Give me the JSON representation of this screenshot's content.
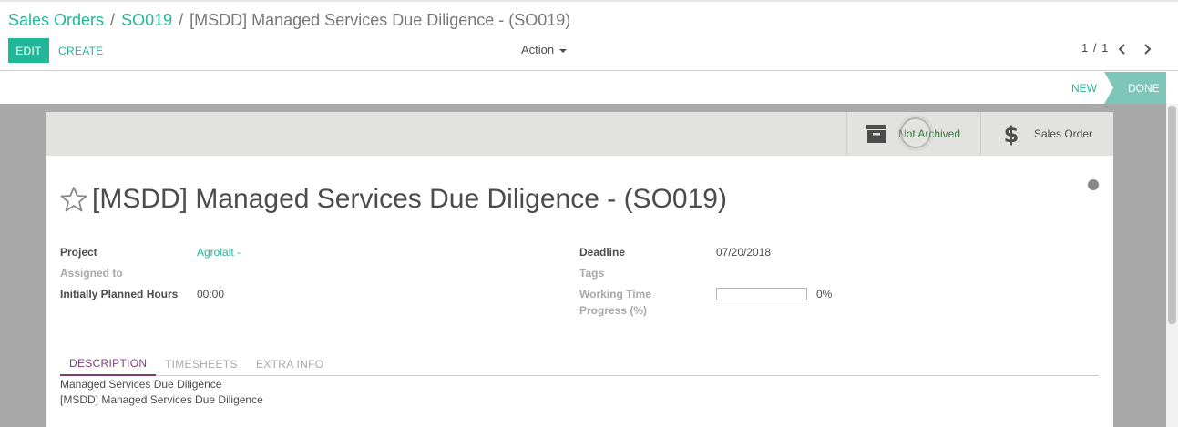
{
  "breadcrumb": {
    "root": "Sales Orders",
    "parent": "SO019",
    "current": "[MSDD] Managed Services Due Diligence - (SO019)",
    "separator": "/"
  },
  "toolbar": {
    "edit_label": "EDIT",
    "create_label": "CREATE",
    "action_label": "Action",
    "pager_text": "1 / 1"
  },
  "statusbar": {
    "stages": [
      "NEW",
      "DONE"
    ],
    "active_stage": "DONE"
  },
  "smart_buttons": {
    "archive_label": "Not Archived",
    "sales_order_label": "Sales Order"
  },
  "record": {
    "title": "[MSDD] Managed Services Due Diligence - (SO019)",
    "fields_left": [
      {
        "label": "Project",
        "value": "Agrolait -"
      },
      {
        "label": "Assigned to",
        "value": ""
      },
      {
        "label": "Initially Planned Hours",
        "value": "00:00"
      }
    ],
    "fields_right": [
      {
        "label": "Deadline",
        "value": "07/20/2018"
      },
      {
        "label": "Tags",
        "value": ""
      },
      {
        "label": "Working Time\nProgress (%)",
        "value": "0%"
      }
    ],
    "progress_fraction": 0
  },
  "notebook": {
    "tabs": [
      "DESCRIPTION",
      "TIMESHEETS",
      "EXTRA INFO"
    ],
    "active_tab": "DESCRIPTION",
    "description_lines": [
      "Managed Services Due Diligence",
      "[MSDD] Managed Services Due Diligence"
    ]
  },
  "colors": {
    "accent": "#21b799",
    "active_tab": "#7c3e79",
    "background": "#a8a8a8"
  }
}
